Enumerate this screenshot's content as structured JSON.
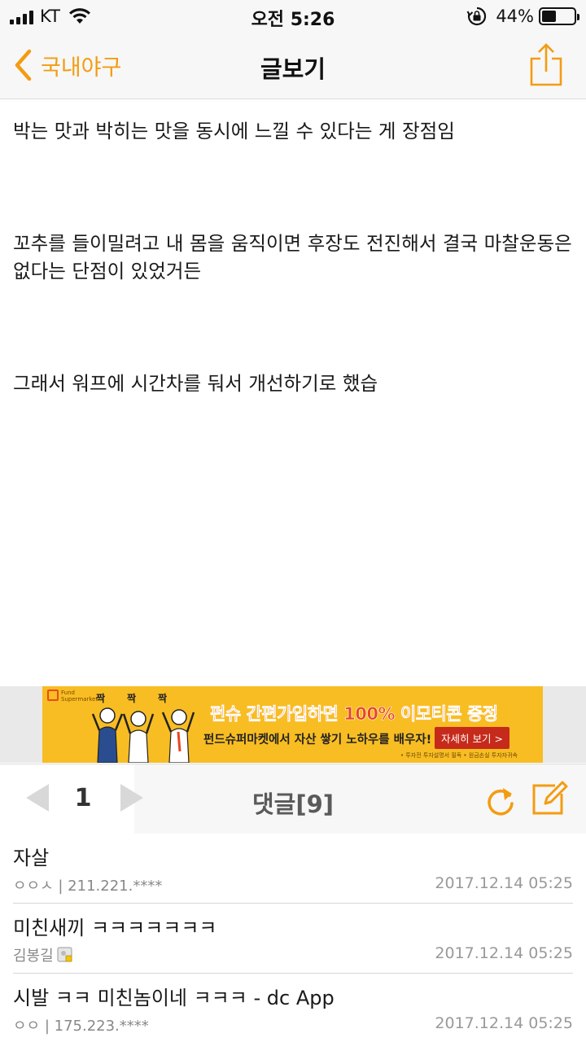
{
  "status_bar": {
    "carrier": "KT",
    "time": "오전 5:26",
    "battery": "44%",
    "battery_level": 0.44
  },
  "nav": {
    "back_label": "국내야구",
    "title": "글보기"
  },
  "article": {
    "paragraphs": [
      "박는 맛과 박히는 맛을 동시에 느낄 수 있다는 게 장점임",
      "꼬추를 들이밀려고 내 몸을 움직이면 후장도 전진해서 결국 마찰운동은 없다는 단점이 있었거든",
      "그래서 워프에 시간차를 둬서 개선하기로 했습"
    ]
  },
  "ad": {
    "logo": "Fund Supermarket",
    "jjak": [
      "짝",
      "짝",
      "짝"
    ],
    "headline": "펀슈 간편가입하면 100% 이모티콘 증정",
    "sub": "펀드슈퍼마켓에서 자산 쌓기 노하우를 배우자!",
    "cta": "자세히 보기 >",
    "note": "• 투자전 투자설명서 필독 • 원금손실 투자자귀속"
  },
  "comments_bar": {
    "page": "1",
    "title": "댓글[9]"
  },
  "comments": [
    {
      "text": "자살",
      "author": "ㅇㅇㅅ | 211.221.****",
      "date": "2017.12.14 05:25",
      "badge": false
    },
    {
      "text": "미친새끼 ㅋㅋㅋㅋㅋㅋㅋ",
      "author": "김봉길",
      "date": "2017.12.14 05:25",
      "badge": true
    },
    {
      "text": "시발 ㅋㅋ 미친놈이네 ㅋㅋㅋ  - dc App",
      "author": "ㅇㅇ | 175.223.****",
      "date": "2017.12.14 05:25",
      "badge": false
    }
  ],
  "colors": {
    "accent": "#f39c12",
    "ad_background": "#f8bd23"
  },
  "icons": [
    "signal-icon",
    "wifi-icon",
    "rotation-lock-icon",
    "battery-icon",
    "back-chevron-icon",
    "share-icon",
    "prev-arrow-icon",
    "next-arrow-icon",
    "refresh-icon",
    "write-icon",
    "user-badge-icon"
  ]
}
